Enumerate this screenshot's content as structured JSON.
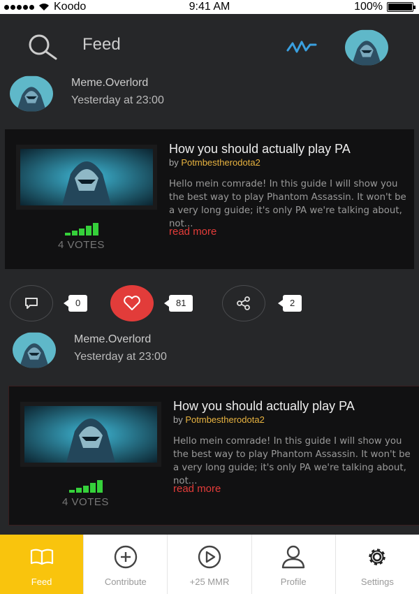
{
  "status_bar": {
    "carrier": "Koodo",
    "time": "9:41 AM",
    "battery": "100%"
  },
  "header": {
    "title": "Feed"
  },
  "posts": [
    {
      "author": "Meme.Overlord",
      "timestamp": "Yesterday at 23:00",
      "headline": "How you should actually play PA",
      "by_prefix": "by",
      "by_user": "Potmbestherodota2",
      "excerpt": "Hello mein comrade! In this guide I will show you the best way to play Phantom Assassin. It won't be a very long guide; it's only PA we're talking about, not...",
      "read_more": "read more",
      "votes": "4 VOTES",
      "comments": "0",
      "likes": "81",
      "shares": "2"
    },
    {
      "author": "Meme.Overlord",
      "timestamp": "Yesterday at 23:00",
      "headline": "How you should actually play PA",
      "by_prefix": "by",
      "by_user": "Potmbestherodota2",
      "excerpt": "Hello mein comrade! In this guide I will show you the best way to play Phantom Assassin. It won't be a very long guide; it's only PA we're talking about, not...",
      "read_more": "read more",
      "votes": "4 VOTES"
    }
  ],
  "tabs": [
    {
      "label": "Feed",
      "icon": "book-icon",
      "active": true
    },
    {
      "label": "Contribute",
      "icon": "plus-circle-icon",
      "active": false
    },
    {
      "label": "+25 MMR",
      "icon": "play-circle-icon",
      "active": false
    },
    {
      "label": "Profile",
      "icon": "user-icon",
      "active": false
    },
    {
      "label": "Settings",
      "icon": "gear-icon",
      "active": false
    }
  ],
  "colors": {
    "background": "#262729",
    "card": "#111112",
    "accent": "#f9c40d",
    "like": "#e23c3a",
    "link": "#e33c39",
    "author_link": "#e8b340",
    "vote_bars": "#35d13a"
  }
}
